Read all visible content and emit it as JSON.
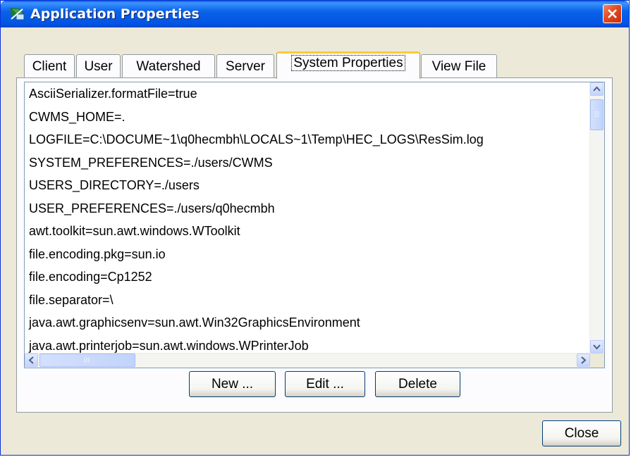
{
  "window": {
    "title": "Application Properties"
  },
  "tabs": [
    {
      "label": "Client"
    },
    {
      "label": "User"
    },
    {
      "label": "Watershed"
    },
    {
      "label": "Server"
    },
    {
      "label": "System Properties",
      "active": true
    },
    {
      "label": "View File"
    }
  ],
  "properties": [
    "AsciiSerializer.formatFile=true",
    "CWMS_HOME=.",
    "LOGFILE=C:\\DOCUME~1\\q0hecmbh\\LOCALS~1\\Temp\\HEC_LOGS\\ResSim.log",
    "SYSTEM_PREFERENCES=./users/CWMS",
    "USERS_DIRECTORY=./users",
    "USER_PREFERENCES=./users/q0hecmbh",
    "awt.toolkit=sun.awt.windows.WToolkit",
    "file.encoding.pkg=sun.io",
    "file.encoding=Cp1252",
    "file.separator=\\",
    "java.awt.graphicsenv=sun.awt.Win32GraphicsEnvironment",
    "java.awt.printerjob=sun.awt.windows.WPrinterJob"
  ],
  "buttons": {
    "new": "New ...",
    "edit": "Edit ...",
    "delete": "Delete",
    "close": "Close"
  },
  "colors": {
    "titlebar": "#0054e3",
    "close_button": "#e24a22",
    "window_bg": "#ece9d8",
    "active_tab_accent": "#ffc83c"
  },
  "icons": {
    "app": "application-icon",
    "close": "close-icon"
  }
}
